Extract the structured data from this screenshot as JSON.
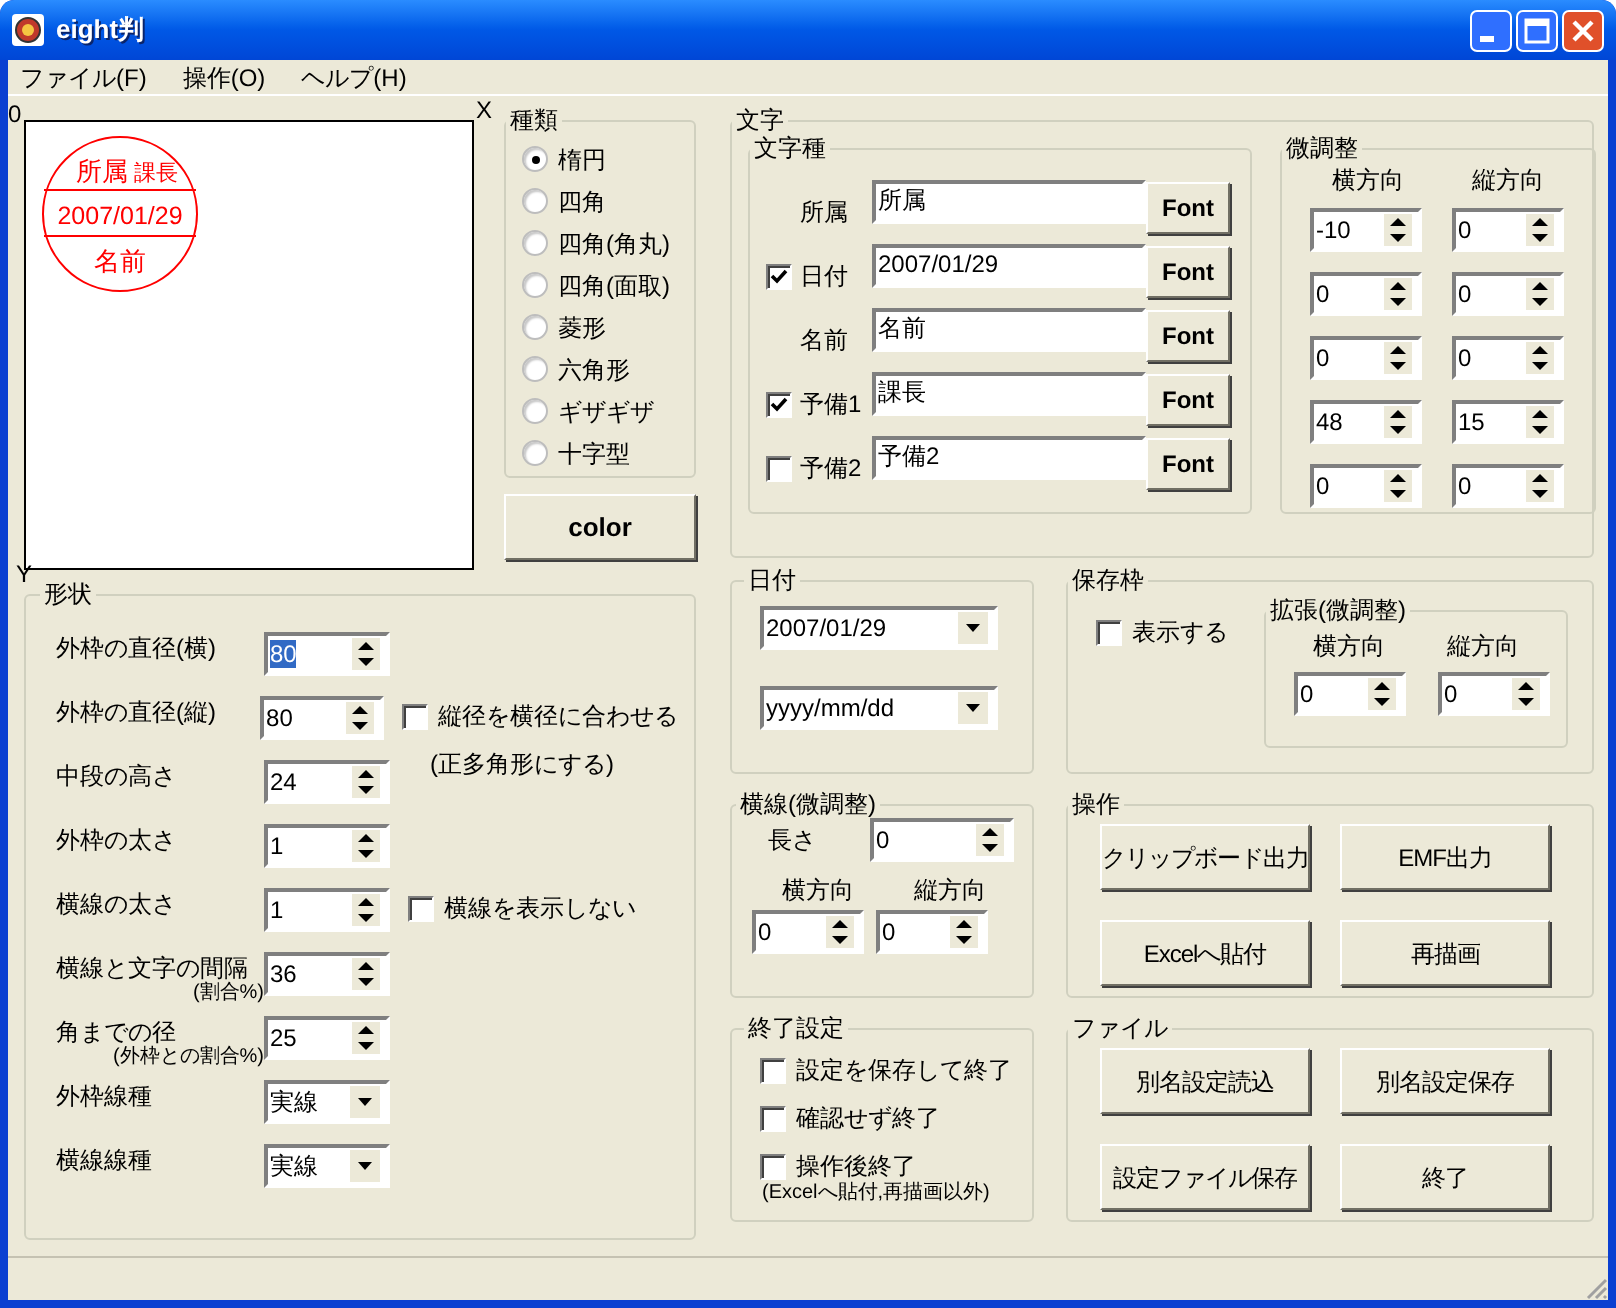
{
  "window": {
    "title": "eight判"
  },
  "menu": [
    "ファイル(F)",
    "操作(O)",
    "ヘルプ(H)"
  ],
  "canvas": {
    "origin": "0",
    "x_axis": "X",
    "y_axis": "Y",
    "stamp": {
      "top": "所属",
      "top_extra": "課長",
      "middle": "2007/01/29",
      "bottom": "名前"
    }
  },
  "shape_type": {
    "title": "種類",
    "options": [
      {
        "label": "楕円",
        "selected": true
      },
      {
        "label": "四角",
        "selected": false
      },
      {
        "label": "四角(角丸)",
        "selected": false
      },
      {
        "label": "四角(面取)",
        "selected": false
      },
      {
        "label": "菱形",
        "selected": false
      },
      {
        "label": "六角形",
        "selected": false
      },
      {
        "label": "ギザギザ",
        "selected": false
      },
      {
        "label": "十字型",
        "selected": false
      }
    ]
  },
  "color_button": "color",
  "shape": {
    "title": "形状",
    "rows": [
      {
        "kind": "spin",
        "label": "外枠の直径(横)",
        "value": "80",
        "focused": true
      },
      {
        "kind": "spin",
        "label": "外枠の直径(縦)",
        "value": "80",
        "focused": false,
        "option": {
          "label": "縦径を横径に合わせる",
          "checked": false,
          "note": "(正多角形にする)"
        }
      },
      {
        "kind": "spin",
        "label": "中段の高さ",
        "value": "24",
        "focused": false
      },
      {
        "kind": "spin",
        "label": "外枠の太さ",
        "value": "1",
        "focused": false
      },
      {
        "kind": "spin",
        "label": "横線の太さ",
        "value": "1",
        "focused": false,
        "option": {
          "label": "横線を表示しない",
          "checked": false
        }
      },
      {
        "kind": "spin",
        "label": "横線と文字の間隔",
        "note": "(割合%)",
        "value": "36",
        "focused": false
      },
      {
        "kind": "spin",
        "label": "角までの径",
        "note": "(外枠との割合%)",
        "value": "25",
        "focused": false
      },
      {
        "kind": "select",
        "label": "外枠線種",
        "value": "実線"
      },
      {
        "kind": "select",
        "label": "横線線種",
        "value": "実線"
      }
    ]
  },
  "text": {
    "title": "文字",
    "types": {
      "title": "文字種",
      "rows": [
        {
          "kind": "plain",
          "label": "所属",
          "value": "所属",
          "button": "Font"
        },
        {
          "kind": "check",
          "label": "日付",
          "checked": true,
          "value": "2007/01/29",
          "button": "Font"
        },
        {
          "kind": "plain",
          "label": "名前",
          "value": "名前",
          "button": "Font"
        },
        {
          "kind": "check",
          "label": "予備1",
          "checked": true,
          "value": "課長",
          "button": "Font"
        },
        {
          "kind": "check",
          "label": "予備2",
          "checked": false,
          "value": "予備2",
          "button": "Font"
        }
      ]
    },
    "adjust": {
      "title": "微調整",
      "headers": [
        "横方向",
        "縦方向"
      ],
      "rows": [
        [
          "-10",
          "0"
        ],
        [
          "0",
          "0"
        ],
        [
          "0",
          "0"
        ],
        [
          "48",
          "15"
        ],
        [
          "0",
          "0"
        ]
      ]
    }
  },
  "date": {
    "title": "日付",
    "date": "2007/01/29",
    "format": "yyyy/mm/dd"
  },
  "save_frame": {
    "title": "保存枠",
    "show": {
      "label": "表示する",
      "checked": false
    },
    "expand": {
      "title": "拡張(微調整)",
      "headers": [
        "横方向",
        "縦方向"
      ],
      "values": [
        "0",
        "0"
      ]
    }
  },
  "hline": {
    "title": "横線(微調整)",
    "length_label": "長さ",
    "length": "0",
    "headers": [
      "横方向",
      "縦方向"
    ],
    "values": [
      "0",
      "0"
    ]
  },
  "operations": {
    "title": "操作",
    "buttons": [
      "クリップボード出力",
      "EMF出力",
      "Excelへ貼付",
      "再描画"
    ]
  },
  "exit": {
    "title": "終了設定",
    "options": [
      {
        "label": "設定を保存して終了",
        "checked": false
      },
      {
        "label": "確認せず終了",
        "checked": false
      },
      {
        "label": "操作後終了",
        "checked": false,
        "note": "(Excelへ貼付,再描画以外)"
      }
    ]
  },
  "file": {
    "title": "ファイル",
    "buttons": [
      "別名設定読込",
      "別名設定保存",
      "設定ファイル保存",
      "終了"
    ]
  }
}
